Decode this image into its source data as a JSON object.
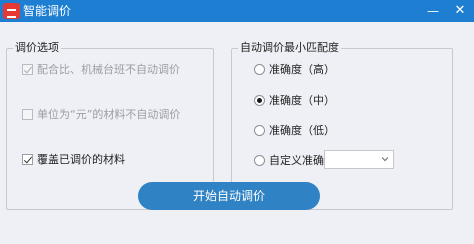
{
  "window": {
    "title": "智能调价",
    "minimize_glyph": "—",
    "close_glyph": "✕"
  },
  "left_group": {
    "label": "调价选项",
    "options": [
      {
        "label": "配合比、机械台班不自动调价",
        "checked": true,
        "enabled": false
      },
      {
        "label": "单位为“元”的材料不自动调价",
        "checked": false,
        "enabled": false
      },
      {
        "label": "覆盖已调价的材料",
        "checked": true,
        "enabled": true
      }
    ]
  },
  "right_group": {
    "label": "自动调价最小匹配度",
    "options": [
      {
        "label": "准确度（高）",
        "selected": false
      },
      {
        "label": "准确度（中）",
        "selected": true
      },
      {
        "label": "准确度（低）",
        "selected": false
      },
      {
        "label": "自定义准确度",
        "selected": false
      }
    ],
    "custom_select_value": ""
  },
  "start_button": {
    "label": "开始自动调价"
  },
  "colors": {
    "titlebar": "#1e7fd2",
    "button": "#2f82c4",
    "app_icon": "#e53935",
    "background": "#eef0f5"
  },
  "icons": {
    "app": "app-logo-icon",
    "minimize": "minimize-icon",
    "close": "close-icon",
    "dropdown": "chevron-down-icon"
  }
}
